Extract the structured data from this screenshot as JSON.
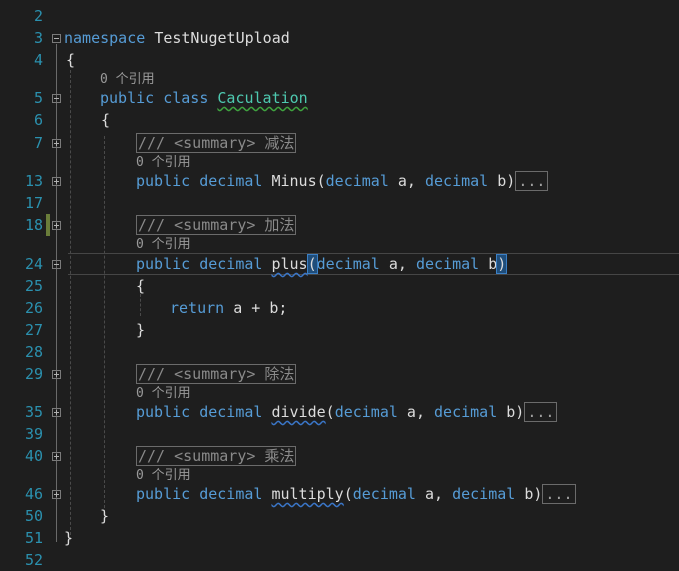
{
  "editor": {
    "colors": {
      "background": "#1e1e1e",
      "line_number": "#2b91af",
      "keyword": "#569cd6",
      "type": "#4ec9b0",
      "comment": "#8a8a8a"
    },
    "lines": [
      {
        "num": "2"
      },
      {
        "num": "3",
        "kw": "namespace",
        "name": "TestNugetUpload"
      },
      {
        "num": "4",
        "text": "{"
      },
      {
        "ref": "0 个引用"
      },
      {
        "num": "5",
        "kw1": "public",
        "kw2": "class",
        "cls": "Caculation"
      },
      {
        "num": "6",
        "text": "{"
      },
      {
        "num": "7",
        "summary": "/// <summary> 减法"
      },
      {
        "ref": "0 个引用"
      },
      {
        "num": "13",
        "kw1": "public",
        "kw2": "decimal",
        "method": "Minus",
        "open": "(",
        "p1type": "decimal",
        "p1": " a, ",
        "p2type": "decimal",
        "p2": " b)",
        "ellipsis": "..."
      },
      {
        "num": "17"
      },
      {
        "num": "18",
        "summary": "/// <summary> 加法"
      },
      {
        "ref": "0 个引用"
      },
      {
        "num": "24",
        "kw1": "public",
        "kw2": "decimal",
        "method": "plus",
        "open": "(",
        "p1type": "decimal",
        "p1": " a, ",
        "p2type": "decimal",
        "p2": " b",
        "close": ")"
      },
      {
        "num": "25",
        "text": "{"
      },
      {
        "num": "26",
        "kw": "return",
        "expr": " a + b;"
      },
      {
        "num": "27",
        "text": "}"
      },
      {
        "num": "28"
      },
      {
        "num": "29",
        "summary": "/// <summary> 除法"
      },
      {
        "ref": "0 个引用"
      },
      {
        "num": "35",
        "kw1": "public",
        "kw2": "decimal",
        "method": "divide",
        "open": "(",
        "p1type": "decimal",
        "p1": " a, ",
        "p2type": "decimal",
        "p2": " b)",
        "ellipsis": "..."
      },
      {
        "num": "39"
      },
      {
        "num": "40",
        "summary": "/// <summary> 乘法"
      },
      {
        "ref": "0 个引用"
      },
      {
        "num": "46",
        "kw1": "public",
        "kw2": "decimal",
        "method": "multiply",
        "open": "(",
        "p1type": "decimal",
        "p1": " a, ",
        "p2type": "decimal",
        "p2": " b)",
        "ellipsis": "..."
      },
      {
        "num": "50",
        "text": "}"
      },
      {
        "num": "51",
        "text": "}"
      },
      {
        "num": "52"
      }
    ]
  }
}
